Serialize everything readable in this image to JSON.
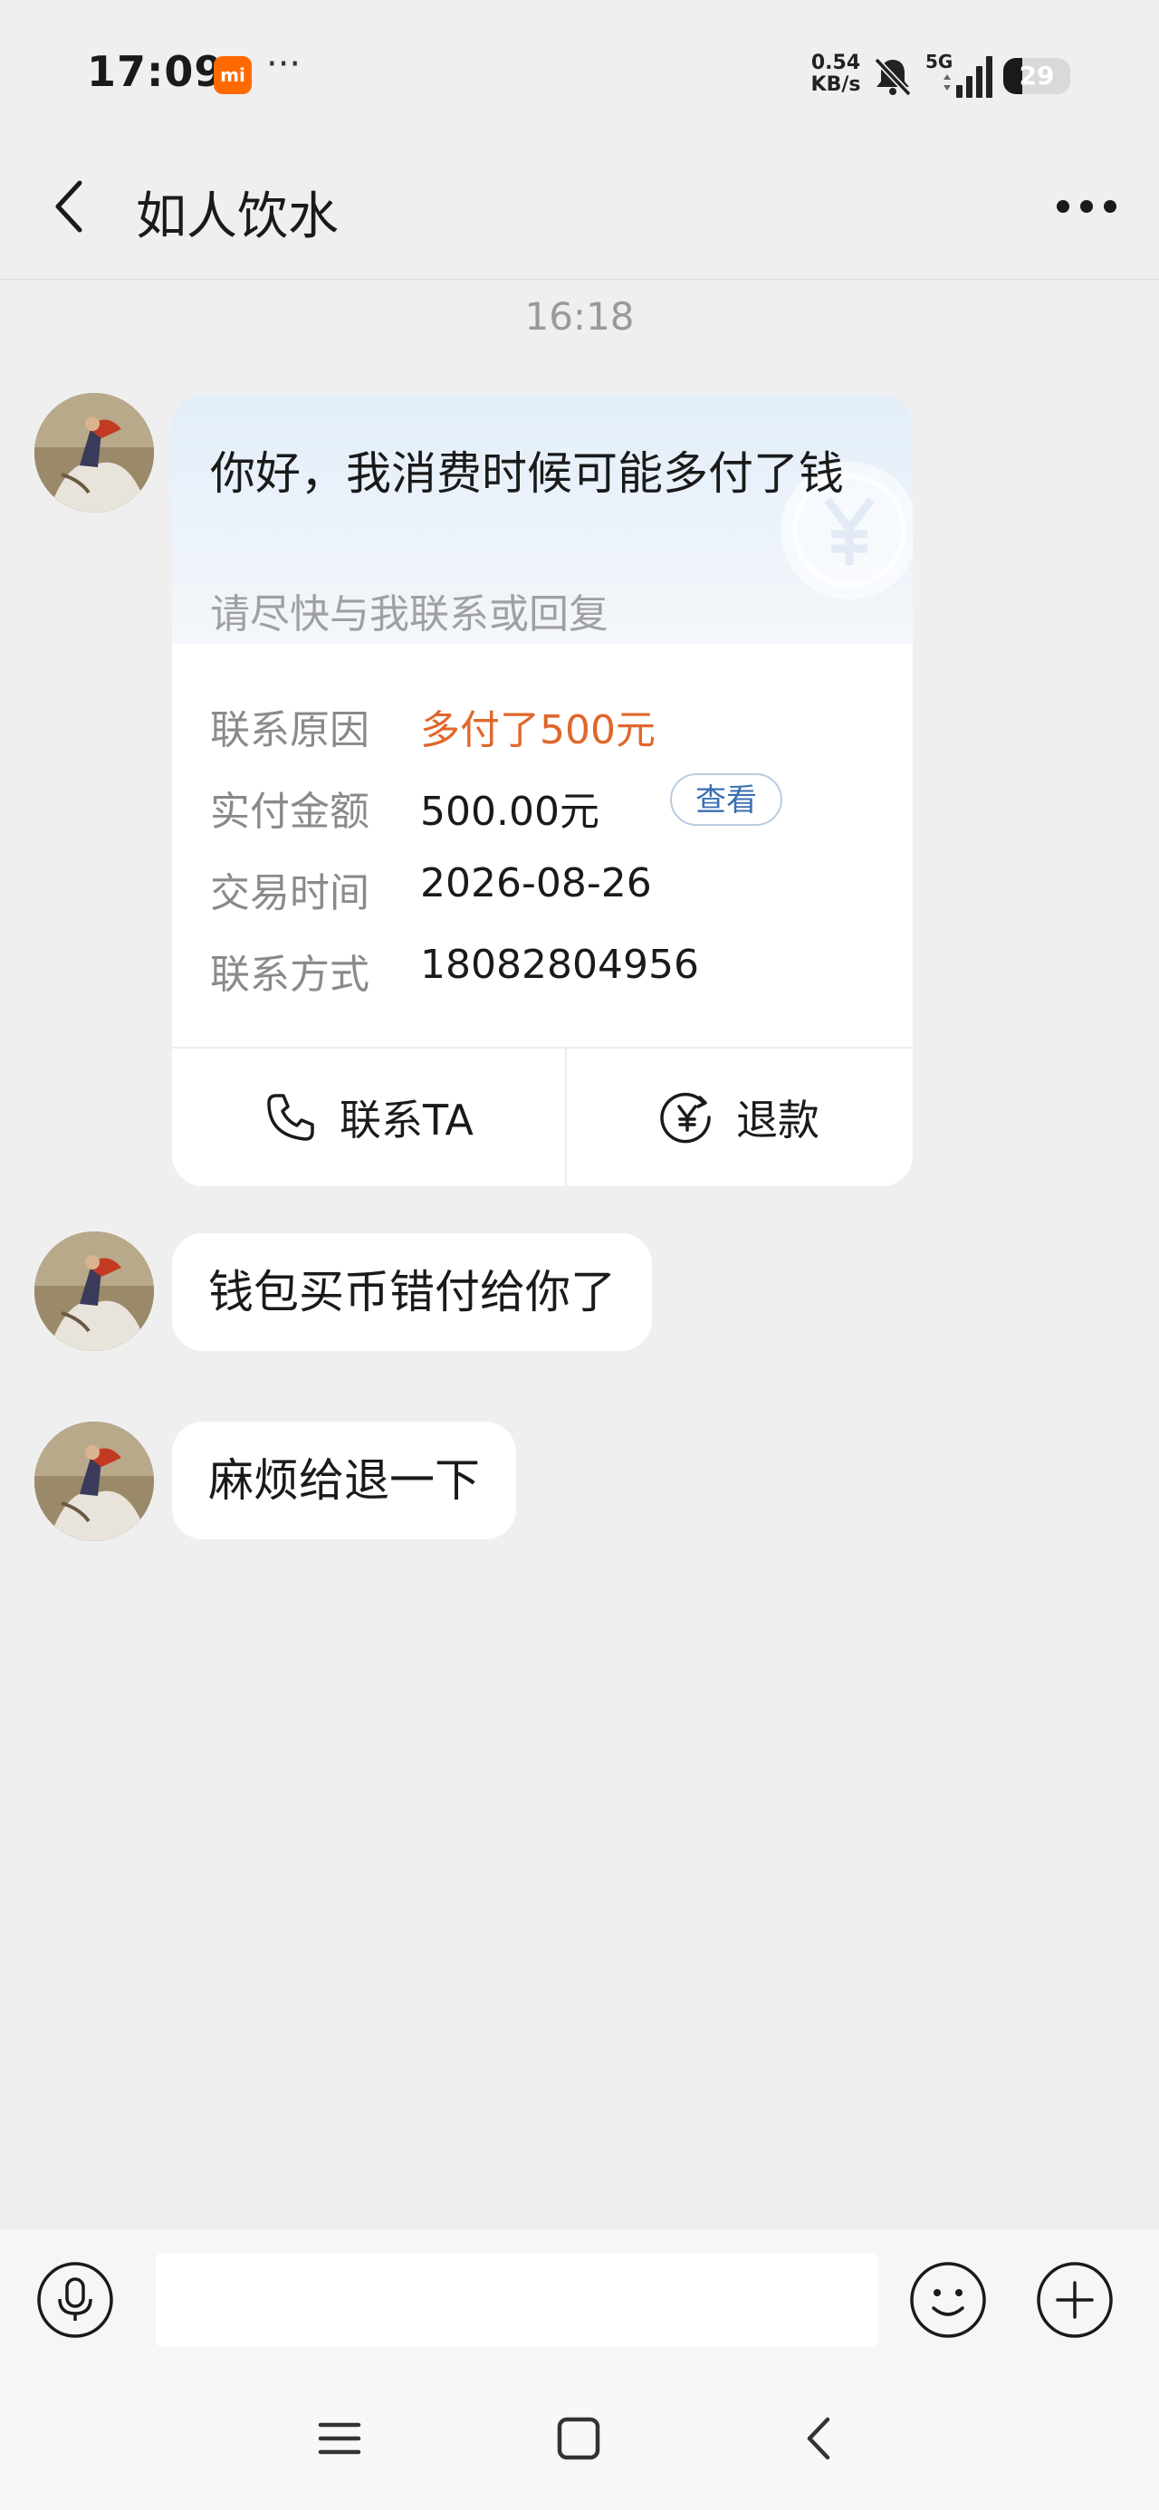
{
  "status_bar": {
    "time": "17:09",
    "mi_badge": "mi",
    "dots": "···",
    "net_speed_value": "0.54",
    "net_speed_unit": "KB/s",
    "network": "5G",
    "battery": "29",
    "battery_level": 0.29
  },
  "header": {
    "title": "如人饮水"
  },
  "chat": {
    "timestamp": "16:18",
    "card": {
      "title": "你好，我消费时候可能多付了钱",
      "subtitle": "请尽快与我联系或回复",
      "rows": [
        {
          "label": "联系原因",
          "value": "多付了500元"
        },
        {
          "label": "实付金额",
          "value": "500.00元",
          "button": "查看"
        },
        {
          "label": "交易时间",
          "value": "2026-08-26"
        },
        {
          "label": "联系方式",
          "value": "18082804956"
        }
      ],
      "actions": {
        "contact": "联系TA",
        "refund": "退款"
      }
    },
    "messages": [
      {
        "text": "钱包买币错付给你了"
      },
      {
        "text": "麻烦给退一下"
      }
    ]
  },
  "input": {
    "placeholder": ""
  },
  "colors": {
    "accent_orange": "#e0672b",
    "link_blue": "#3a6fb0",
    "background": "#efefef"
  }
}
